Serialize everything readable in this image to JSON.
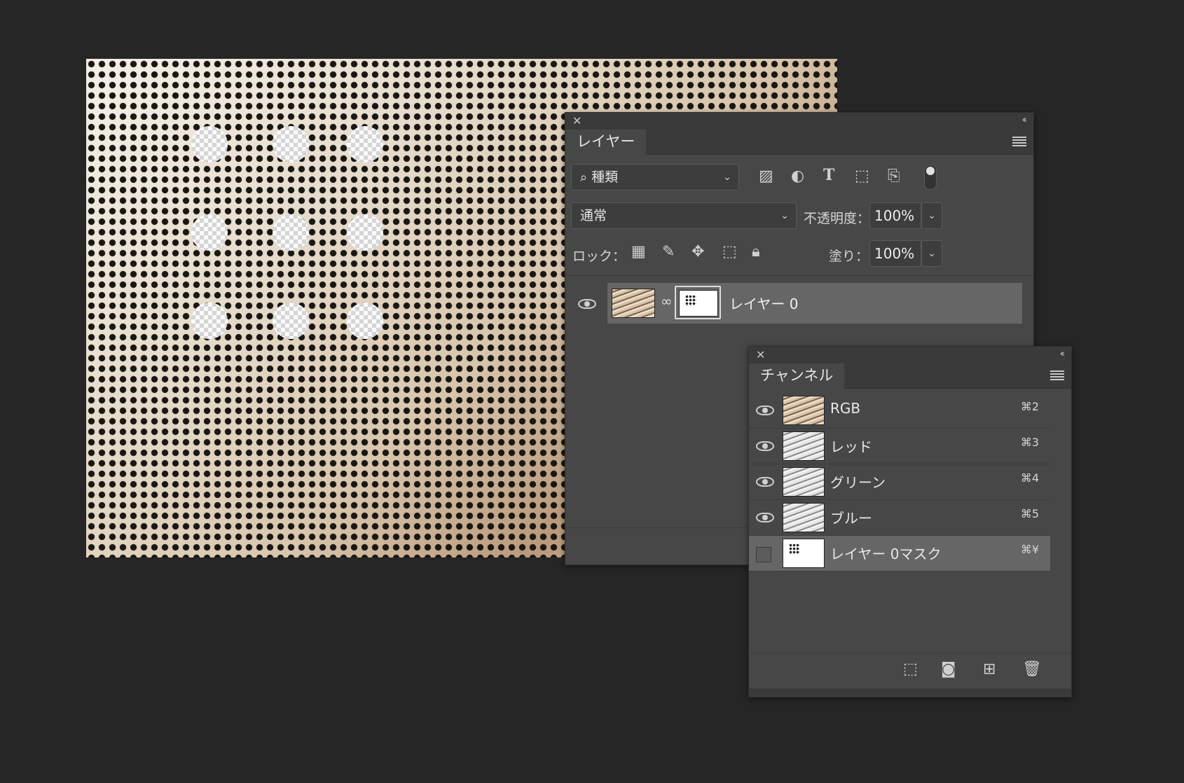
{
  "layers_panel": {
    "tab": "レイヤー",
    "filter": {
      "label": "種類"
    },
    "blend_mode": "通常",
    "opacity": {
      "label": "不透明度：",
      "value": "100%"
    },
    "lock": {
      "label": "ロック："
    },
    "fill": {
      "label": "塗り：",
      "value": "100%"
    },
    "layers": [
      {
        "name": "レイヤー 0"
      }
    ]
  },
  "channels_panel": {
    "tab": "チャンネル",
    "channels": [
      {
        "name": "RGB",
        "shortcut": "⌘2"
      },
      {
        "name": "レッド",
        "shortcut": "⌘3"
      },
      {
        "name": "グリーン",
        "shortcut": "⌘4"
      },
      {
        "name": "ブルー",
        "shortcut": "⌘5"
      },
      {
        "name": "レイヤー 0マスク",
        "shortcut": "⌘¥"
      }
    ]
  },
  "icons": {
    "filter_bar": [
      "image-filter-icon",
      "adjustment-filter-icon",
      "type-filter-icon",
      "shape-filter-icon",
      "smart-object-filter-icon",
      "filter-toggle-icon"
    ],
    "lock_bar": [
      "lock-transparent-icon",
      "lock-paint-icon",
      "lock-position-icon",
      "lock-artboard-icon",
      "lock-all-icon"
    ],
    "channel_footer": [
      "load-selection-icon",
      "save-selection-icon",
      "new-channel-icon",
      "delete-channel-icon"
    ]
  }
}
